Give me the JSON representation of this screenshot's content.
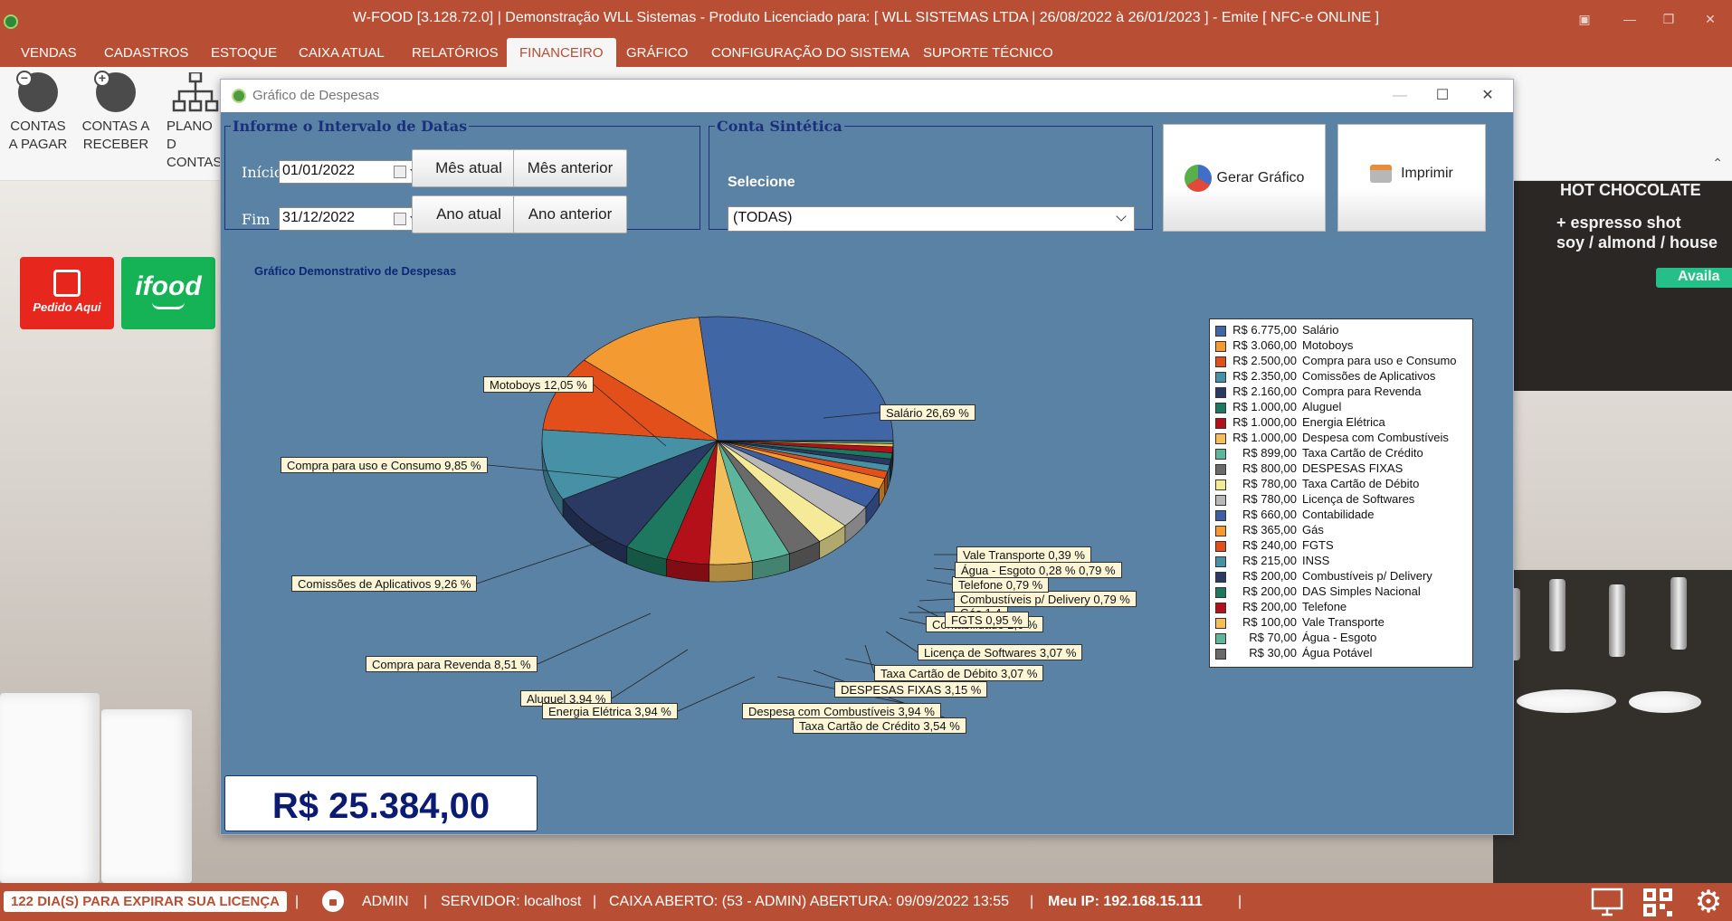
{
  "app": {
    "title": "W-FOOD [3.128.72.0] | Demonstração WLL Sistemas - Produto Licenciado para:  [ WLL SISTEMAS LTDA | 26/08/2022 à 26/01/2023 ]  - Emite [ NFC-e ONLINE ]"
  },
  "menu": [
    {
      "label": "VENDAS"
    },
    {
      "label": "CADASTROS"
    },
    {
      "label": "ESTOQUE"
    },
    {
      "label": "CAIXA ATUAL"
    },
    {
      "label": "RELATÓRIOS"
    },
    {
      "label": "FINANCEIRO"
    },
    {
      "label": "GRÁFICO"
    },
    {
      "label": "CONFIGURAÇÃO DO SISTEMA"
    },
    {
      "label": "SUPORTE TÉCNICO"
    }
  ],
  "ribbon": {
    "contas_pagar": {
      "line1": "CONTAS",
      "line2": "A PAGAR"
    },
    "contas_receber": {
      "line1": "CONTAS A",
      "line2": "RECEBER"
    },
    "plano_contas": {
      "line1": "PLANO D",
      "line2": "CONTAS"
    }
  },
  "promo": {
    "pedido": "Pedido Aqui",
    "ifood": "ifood"
  },
  "background": {
    "board_line1": "HOT CHOCOLATE",
    "board_line2": "+ espresso shot",
    "board_line3": "soy / almond / house",
    "board_line4": "Availa"
  },
  "dialog": {
    "title": "Gráfico de Despesas",
    "interval": {
      "legend": "Informe o Intervalo de Datas",
      "inicio_label": "Início",
      "inicio_value": "01/01/2022",
      "fim_label": "Fim",
      "fim_value": "31/12/2022",
      "mes_atual": "Mês atual",
      "mes_anterior": "Mês anterior",
      "ano_atual": "Ano atual",
      "ano_anterior": "Ano anterior"
    },
    "conta": {
      "legend": "Conta Sintética",
      "selecione": "Selecione",
      "selected": "(TODAS)"
    },
    "gerar": "Gerar Gráfico",
    "imprimir": "Imprimir",
    "total": "R$ 25.384,00"
  },
  "chart_data": {
    "type": "pie",
    "title": "Gráfico Demonstrativo de Despesas",
    "unit": "R$",
    "slices": [
      {
        "name": "Salário",
        "value": 6775,
        "display": "R$ 6.775,00",
        "label": "Salário 26,69 %",
        "color": "#4166a6"
      },
      {
        "name": "Motoboys",
        "value": 3060,
        "display": "R$ 3.060,00",
        "label": "Motoboys 12,05 %",
        "color": "#f39a33"
      },
      {
        "name": "Compra para uso e Consumo",
        "value": 2500,
        "display": "R$ 2.500,00",
        "label": "Compra para uso e Consumo 9,85 %",
        "color": "#e24f1a"
      },
      {
        "name": "Comissões de Aplicativos",
        "value": 2350,
        "display": "R$ 2.350,00",
        "label": "Comissões de Aplicativos 9,26 %",
        "color": "#4791a6"
      },
      {
        "name": "Compra para Revenda",
        "value": 2160,
        "display": "R$ 2.160,00",
        "label": "Compra para Revenda 8,51 %",
        "color": "#2a3a63"
      },
      {
        "name": "Aluguel",
        "value": 1000,
        "display": "R$ 1.000,00",
        "label": "Aluguel 3,94 %",
        "color": "#1e7860"
      },
      {
        "name": "Energia Elétrica",
        "value": 1000,
        "display": "R$ 1.000,00",
        "label": "Energia Elétrica 3,94 %",
        "color": "#b3101a"
      },
      {
        "name": "Despesa com Combustíveis",
        "value": 1000,
        "display": "R$ 1.000,00",
        "label": "Despesa com Combustíveis 3,94 %",
        "color": "#f3bf5b"
      },
      {
        "name": "Taxa Cartão de Crédito",
        "value": 899,
        "display": "R$ 899,00",
        "label": "Taxa Cartão de Crédito 3,54 %",
        "color": "#5db69b"
      },
      {
        "name": "DESPESAS FIXAS",
        "value": 800,
        "display": "R$ 800,00",
        "label": "DESPESAS FIXAS 3,15 %",
        "color": "#6a6a6a"
      },
      {
        "name": "Taxa Cartão de Débito",
        "value": 780,
        "display": "R$ 780,00",
        "label": "Taxa Cartão de Débito 3,07 %",
        "color": "#f5ea98"
      },
      {
        "name": "Licença de Softwares",
        "value": 780,
        "display": "R$ 780,00",
        "label": "Licença de Softwares 3,07 %",
        "color": "#b8b8b8"
      },
      {
        "name": "Contabilidade",
        "value": 660,
        "display": "R$ 660,00",
        "label": "Contabilidade 2,6 %",
        "color": "#3d5ea3"
      },
      {
        "name": "Gás",
        "value": 365,
        "display": "R$ 365,00",
        "label": "Gás 1,4",
        "color": "#f39a33"
      },
      {
        "name": "FGTS",
        "value": 240,
        "display": "R$ 240,00",
        "label": "FGTS 0,95 %",
        "color": "#e24f1a"
      },
      {
        "name": "INSS",
        "value": 215,
        "display": "R$ 215,00",
        "label": "",
        "color": "#4791a6"
      },
      {
        "name": "Combustíveis p/ Delivery",
        "value": 200,
        "display": "R$ 200,00",
        "label": "Combustíveis p/ Delivery 0,79 %",
        "color": "#2a3a63"
      },
      {
        "name": "DAS Simples Nacional",
        "value": 200,
        "display": "R$ 200,00",
        "label": "",
        "color": "#1e7860"
      },
      {
        "name": "Telefone",
        "value": 200,
        "display": "R$ 200,00",
        "label": "Telefone 0,79 %",
        "color": "#b3101a"
      },
      {
        "name": "Vale Transporte",
        "value": 100,
        "display": "R$ 100,00",
        "label": "Vale Transporte 0,39 %",
        "color": "#f3bf5b"
      },
      {
        "name": "Água - Esgoto",
        "value": 70,
        "display": "R$ 70,00",
        "label": "Água - Esgoto 0,28 % 0,79 %",
        "color": "#5db69b"
      },
      {
        "name": "Água Potável",
        "value": 30,
        "display": "R$ 30,00",
        "label": "",
        "color": "#6a6a6a"
      }
    ]
  },
  "status": {
    "license": "122 DIA(S) PARA EXPIRAR SUA LICENÇA",
    "user": "ADMIN",
    "server": "SERVIDOR: localhost",
    "caixa": "CAIXA ABERTO: (53 - ADMIN) ABERTURA: 09/09/2022 13:55",
    "ip": "Meu IP: 192.168.15.111",
    "sep": "|"
  }
}
